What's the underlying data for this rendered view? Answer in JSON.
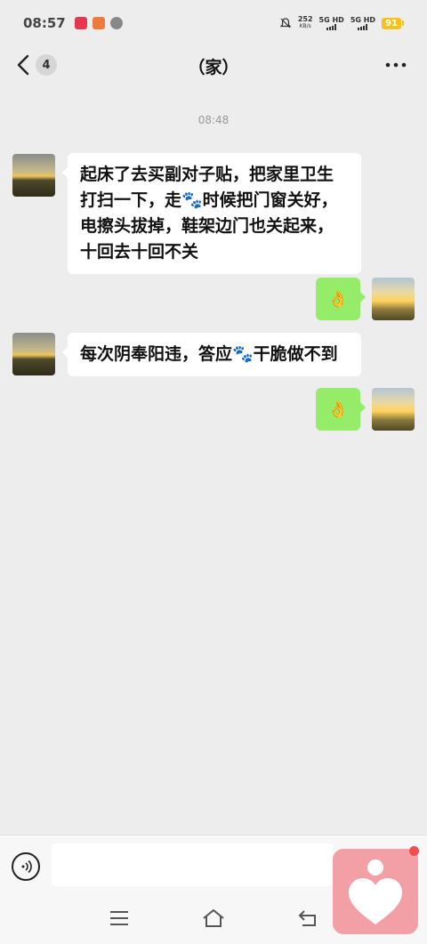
{
  "status_bar": {
    "time": "08:57",
    "net_speed_value": "252",
    "net_speed_unit": "KB/s",
    "signal_1": "5G HD",
    "signal_2": "5G HD",
    "battery": "91"
  },
  "header": {
    "unread_count": "4",
    "title": "（家）"
  },
  "chat": {
    "timestamp": "08:48",
    "messages": [
      {
        "from": "other",
        "text": "起床了去买副对子贴，把家里卫生打扫一下，走🐾时候把门窗关好，电擦头拔掉，鞋架边门也关起来，十回去十回不关"
      },
      {
        "from": "me",
        "text": "👌"
      },
      {
        "from": "other",
        "text": "每次阴奉阳违，答应🐾干脆做不到"
      },
      {
        "from": "me",
        "text": "👌"
      }
    ]
  },
  "input": {
    "placeholder": ""
  },
  "colors": {
    "chat_bg": "#ededed",
    "my_bubble": "#95ec69",
    "other_bubble": "#ffffff",
    "widget": "#f2a0a6"
  },
  "icons": [
    "back-chevron-icon",
    "more-icon",
    "voice-icon",
    "menu-icon",
    "home-icon",
    "back-nav-icon",
    "heart-icon"
  ]
}
